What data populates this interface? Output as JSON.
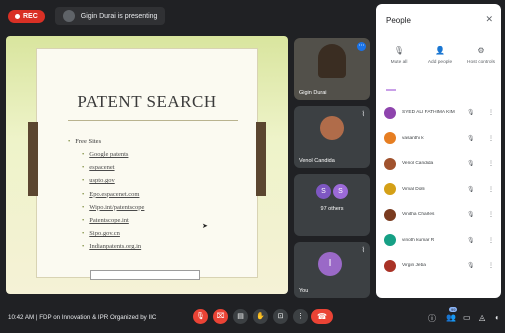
{
  "topbar": {
    "rec_label": "REC",
    "presenting_text": "Gigin Durai is presenting"
  },
  "slide": {
    "title": "PATENT SEARCH",
    "main_bullet": "Free Sites",
    "sub_bullets": [
      "Google patents",
      "espacenet",
      "uspto.gov",
      "Epo.espacenet.com",
      "Wipo.int/patentscope",
      "Patentscope.int",
      "Sipo.gov.cn",
      "Indianpatents.org.in"
    ]
  },
  "tiles": [
    {
      "name": "Gigin Durai",
      "more_icon": "more-icon"
    },
    {
      "name": "Venol Candida",
      "mic_icon": "mic-off-icon"
    },
    {
      "name": "97 others",
      "avatars": [
        "S",
        "S"
      ]
    },
    {
      "name": "You",
      "avatar": "I",
      "mic_icon": "mic-off-icon"
    }
  ],
  "people_panel": {
    "title": "People",
    "close_icon": "close-icon",
    "actions": [
      {
        "label": "Mute all",
        "icon": "mute-all-icon"
      },
      {
        "label": "Add people",
        "icon": "add-people-icon"
      },
      {
        "label": "Host controls",
        "icon": "host-controls-icon"
      }
    ],
    "participants": [
      {
        "name": "SYED ALI FATHIMA KIM",
        "color": "#8e44ad"
      },
      {
        "name": "vasanthi k",
        "color": "#e67e22"
      },
      {
        "name": "Venol Candida",
        "color": "#a0522d"
      },
      {
        "name": "Vimal Dolli",
        "color": "#d4a017"
      },
      {
        "name": "Vinitha Charles",
        "color": "#7a3b1f"
      },
      {
        "name": "vinoth kumar R",
        "color": "#16a085"
      },
      {
        "name": "Virgin Jeba",
        "color": "#a93226"
      }
    ]
  },
  "bottombar": {
    "time": "10:42 AM",
    "separator": "|",
    "meeting_title": "FDP on Innovation & IPR Organized by IIC",
    "participant_badge": "99"
  },
  "colors": {
    "background": "#202124",
    "danger": "#ea4335",
    "panel": "#ffffff"
  }
}
